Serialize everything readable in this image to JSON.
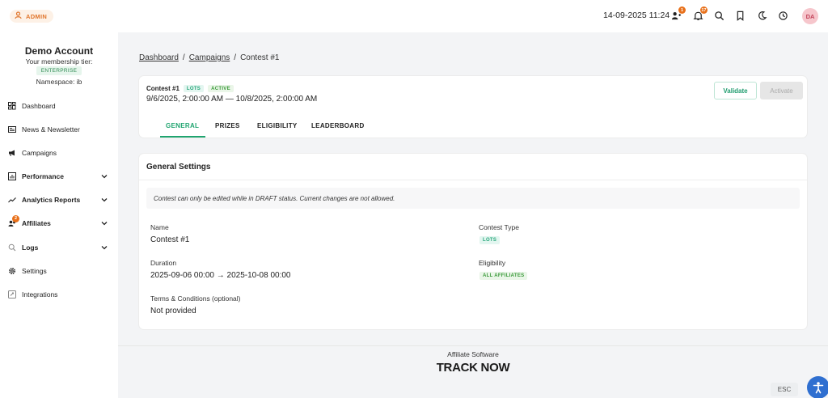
{
  "topbar": {
    "admin_label": "ADMIN",
    "datetime": "14-09-2025 11:24",
    "users_badge": "1",
    "bell_badge": "17",
    "avatar_initials": "DA"
  },
  "sidebar": {
    "account_name": "Demo Account",
    "tier_label": "Your membership tier:",
    "tier_value": "ENTERPRISE",
    "namespace": "Namespace: ib",
    "items": [
      {
        "label": "Dashboard",
        "icon": "dashboard-icon"
      },
      {
        "label": "News & Newsletter",
        "icon": "newspaper-icon"
      },
      {
        "label": "Campaigns",
        "icon": "megaphone-icon"
      },
      {
        "label": "Performance",
        "icon": "chart-box-icon",
        "expandable": true
      },
      {
        "label": "Analytics Reports",
        "icon": "trend-line-icon",
        "expandable": true
      },
      {
        "label": "Affiliates",
        "icon": "users-icon",
        "expandable": true,
        "badge": "2"
      },
      {
        "label": "Logs",
        "icon": "search-icon",
        "expandable": true
      },
      {
        "label": "Settings",
        "icon": "gear-icon"
      },
      {
        "label": "Integrations",
        "icon": "plug-icon"
      }
    ]
  },
  "breadcrumb": {
    "dashboard": "Dashboard",
    "campaigns": "Campaigns",
    "current": "Contest #1",
    "separator": "/"
  },
  "contest": {
    "title": "Contest #1",
    "type_pill": "LOTS",
    "status_pill": "ACTIVE",
    "dates": "9/6/2025, 2:00:00 AM — 10/8/2025, 2:00:00 AM",
    "validate_label": "Validate",
    "activate_label": "Activate",
    "tabs": [
      "GENERAL",
      "PRIZES",
      "ELIGIBILITY",
      "LEADERBOARD"
    ],
    "active_tab": "GENERAL"
  },
  "settings": {
    "title": "General Settings",
    "notice": "Contest can only be edited while in DRAFT status. Current changes are not allowed.",
    "name_label": "Name",
    "name_value": "Contest #1",
    "duration_label": "Duration",
    "duration_value": "2025-09-06 00:00 → 2025-10-08 00:00",
    "terms_label": "Terms & Conditions (optional)",
    "terms_value": "Not provided",
    "type_label": "Contest Type",
    "type_value": "LOTS",
    "eligibility_label": "Eligibility",
    "eligibility_value": "ALL AFFILIATES"
  },
  "footer": {
    "software": "Affiliate Software",
    "logo": "TRACK NOW",
    "esc": "ESC"
  },
  "colors": {
    "accent": "#1fa46f",
    "badge": "#e8701a",
    "accessibility": "#2f6fd0"
  }
}
